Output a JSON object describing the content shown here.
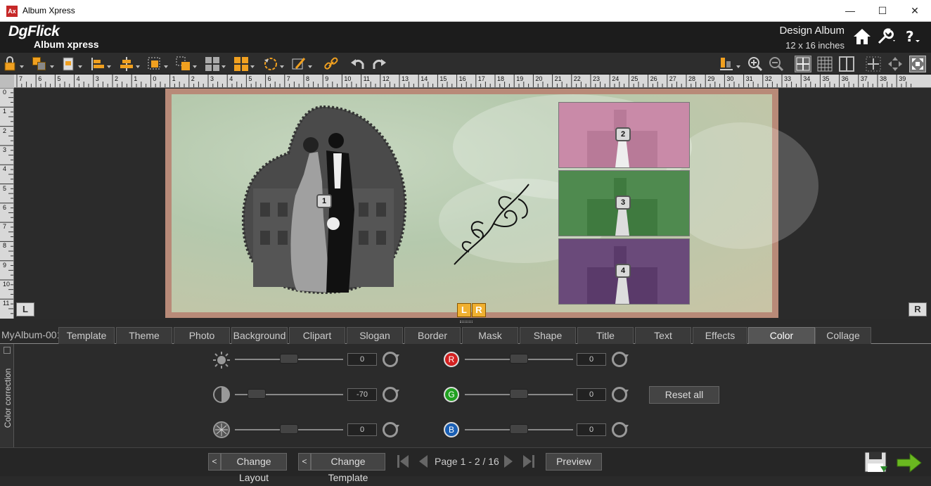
{
  "window": {
    "title": "Album Xpress",
    "icon_text": "Ax",
    "min": "—",
    "max": "☐",
    "close": "✕"
  },
  "header": {
    "logo_line1": "DgFlick",
    "logo_line2": "Album xpress",
    "design_title": "Design Album",
    "size": "12 x 16 inches"
  },
  "rulers": {
    "horizontal": [
      "7",
      "6",
      "5",
      "4",
      "3",
      "2",
      "1",
      "0",
      "1",
      "2",
      "3",
      "4",
      "5",
      "6",
      "7",
      "8",
      "9",
      "10",
      "11",
      "12",
      "13",
      "14",
      "15",
      "16",
      "17",
      "18",
      "19",
      "20",
      "21",
      "22",
      "23",
      "24",
      "25",
      "26",
      "27",
      "28",
      "29",
      "30",
      "31",
      "32",
      "33",
      "34",
      "35",
      "36",
      "37",
      "38",
      "39"
    ],
    "vertical": [
      "0",
      "1",
      "2",
      "3",
      "4",
      "5",
      "6",
      "7",
      "8",
      "9",
      "10",
      "11"
    ]
  },
  "canvas": {
    "left_side": "L",
    "right_side": "R",
    "lr_left": "L",
    "lr_right": "R",
    "photo_numbers": [
      "1",
      "2",
      "3",
      "4"
    ]
  },
  "tabs": {
    "album_name": "MyAlbum-001",
    "items": [
      "Template",
      "Theme",
      "Photo",
      "Background",
      "Clipart",
      "Slogan",
      "Border",
      "Mask",
      "Shape",
      "Title",
      "Text",
      "Effects",
      "Color correction",
      "Collage"
    ],
    "active": "Color correction"
  },
  "panel": {
    "label": "Color correction",
    "brightness": "0",
    "contrast": "-70",
    "saturation": "0",
    "r_label": "R",
    "g_label": "G",
    "b_label": "B",
    "red": "0",
    "green": "0",
    "blue": "0",
    "reset_all": "Reset all"
  },
  "footer": {
    "change_layout": "Change Layout",
    "change_template": "Change Template",
    "back_glyph": "<",
    "page_info": "Page 1 - 2 / 16",
    "preview": "Preview"
  },
  "colors": {
    "accent": "#f0a020",
    "red": "#d32020",
    "green": "#20a020",
    "blue": "#1a5fb4",
    "page_border": "#b88a78"
  }
}
